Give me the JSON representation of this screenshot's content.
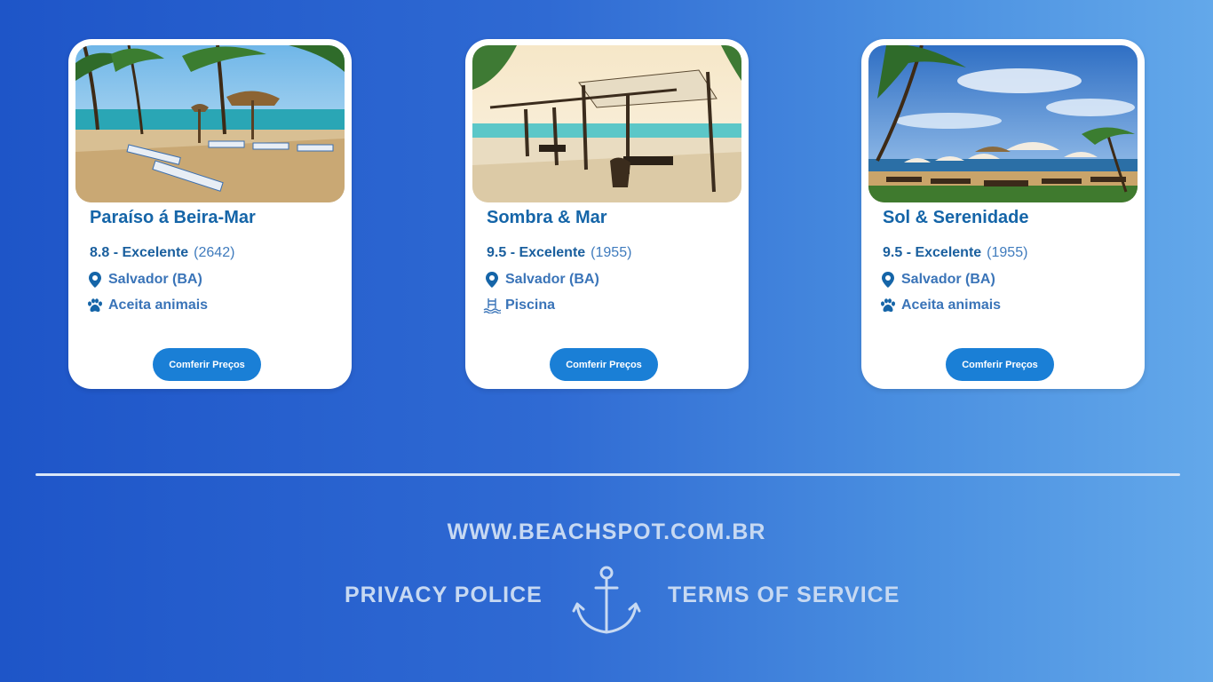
{
  "hotels": [
    {
      "name": "Paraíso á Beira-Mar",
      "score": "8.8 - Excelente",
      "reviews": "(2642)",
      "location": "Salvador (BA)",
      "amenity": "Aceita animais",
      "amenity_icon": "paw-icon",
      "button": "Comferir Preços"
    },
    {
      "name": "Sombra & Mar",
      "score": "9.5 - Excelente",
      "reviews": "(1955)",
      "location": "Salvador (BA)",
      "amenity": "Piscina",
      "amenity_icon": "pool-icon",
      "button": "Comferir Preços"
    },
    {
      "name": "Sol & Serenidade",
      "score": "9.5 - Excelente",
      "reviews": "(1955)",
      "location": "Salvador (BA)",
      "amenity": "Aceita animais",
      "amenity_icon": "paw-icon",
      "button": "Comferir Preços"
    }
  ],
  "footer": {
    "website": "WWW.BEACHSPOT.COM.BR",
    "privacy": "PRIVACY POLICE",
    "terms": "TERMS OF SERVICE",
    "logo_icon": "anchor-icon"
  },
  "colors": {
    "accent": "#1a7fd6",
    "title": "#1565a8",
    "footer_text": "#c7d9f2"
  }
}
